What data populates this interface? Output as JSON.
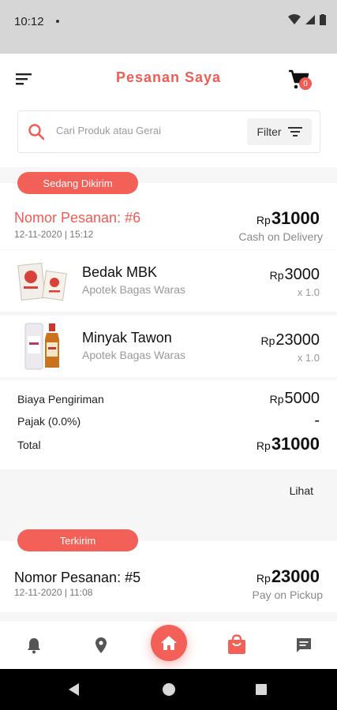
{
  "status_bar": {
    "time": "10:12"
  },
  "header": {
    "title": "Pesanan Saya",
    "cart_count": "0"
  },
  "search": {
    "placeholder": "Cari Produk atau Gerai",
    "filter_label": "Filter"
  },
  "orders": [
    {
      "status": "Sedang Dikirim",
      "number": "Nomor Pesanan: #6",
      "date": "12-11-2020 | 15:12",
      "currency": "Rp",
      "total": "31000",
      "payment": "Cash on Delivery",
      "items": [
        {
          "name": "Bedak MBK",
          "store": "Apotek Bagas Waras",
          "currency": "Rp",
          "price": "3000",
          "qty": "x 1.0"
        },
        {
          "name": "Minyak Tawon",
          "store": "Apotek Bagas Waras",
          "currency": "Rp",
          "price": "23000",
          "qty": "x 1.0"
        }
      ],
      "summary": {
        "shipping_label": "Biaya Pengiriman",
        "shipping_currency": "Rp",
        "shipping_value": "5000",
        "tax_label": "Pajak (0.0%)",
        "tax_value": "-",
        "total_label": "Total",
        "total_currency": "Rp",
        "total_value": "31000"
      },
      "view_label": "Lihat"
    },
    {
      "status": "Terkirim",
      "number": "Nomor Pesanan: #5",
      "date": "12-11-2020 | 11:08",
      "currency": "Rp",
      "total": "23000",
      "payment": "Pay on Pickup"
    }
  ],
  "colors": {
    "accent": "#ef5b55",
    "pill": "#f26058"
  },
  "bottom_nav": [
    "bell-icon",
    "location-icon",
    "home-icon",
    "shopping-bag-icon",
    "chat-icon"
  ]
}
